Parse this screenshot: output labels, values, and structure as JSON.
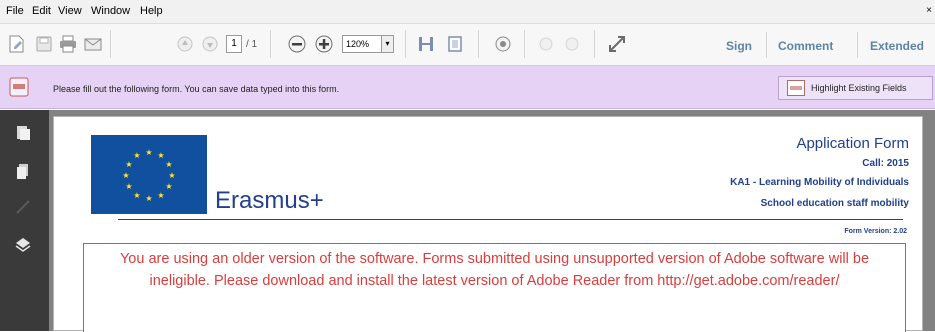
{
  "menubar": {
    "items": [
      "File",
      "Edit",
      "View",
      "Window",
      "Help"
    ],
    "close": "×"
  },
  "toolbar": {
    "page_current": "1",
    "page_total": "/ 1",
    "zoom_value": "120%",
    "zoom_dropdown_glyph": "▾",
    "sign_label": "Sign",
    "comment_label": "Comment",
    "extended_label": "Extended"
  },
  "formbar": {
    "message": "Please fill out the following form. You can save data typed into this form.",
    "highlight_label": "Highlight Existing Fields"
  },
  "document": {
    "erasmus_label": "Erasmus+",
    "title": "Application Form",
    "call": "Call: 2015",
    "action": "KA1 - Learning Mobility of Individuals",
    "field": "School education staff mobility",
    "form_version": "Form Version: 2.02",
    "warning": "You are using an older version of the software. Forms submitted using unsupported version of Adobe software will be ineligible. Please download and install the latest version of Adobe Reader from http://get.adobe.com/reader/"
  },
  "colors": {
    "brand_blue": "#23408e",
    "eu_flag_blue": "#114f9f",
    "eu_star_yellow": "#ffe81a",
    "warning_red": "#d93d3d",
    "formbar_purple": "#e6d2f5",
    "link_blue": "#5e84a6"
  },
  "icons": [
    "create-pdf-icon",
    "save-icon",
    "print-icon",
    "email-icon",
    "prev-page-icon",
    "next-page-icon",
    "zoom-out-icon",
    "zoom-in-icon",
    "fit-width-icon",
    "fit-page-icon",
    "comment-bubble-icon",
    "read-mode-icon",
    "form-icon",
    "attachments-icon",
    "layers-icon",
    "pages-icon"
  ]
}
